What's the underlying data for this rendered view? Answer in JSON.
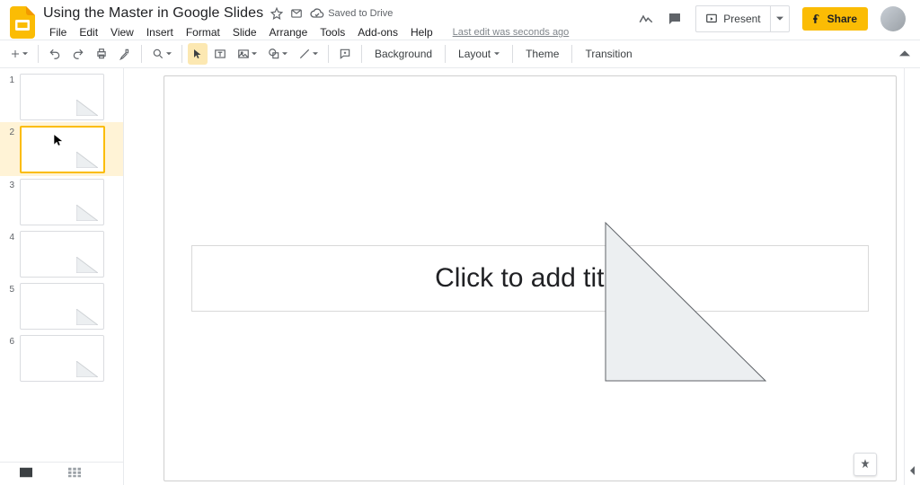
{
  "header": {
    "doc_title": "Using the Master in Google Slides",
    "saved_text": "Saved to Drive",
    "last_edit": "Last edit was seconds ago"
  },
  "menubar": [
    "File",
    "Edit",
    "View",
    "Insert",
    "Format",
    "Slide",
    "Arrange",
    "Tools",
    "Add-ons",
    "Help"
  ],
  "top_buttons": {
    "present": "Present",
    "share": "Share"
  },
  "toolbar": {
    "background": "Background",
    "layout": "Layout",
    "theme": "Theme",
    "transition": "Transition"
  },
  "filmstrip": {
    "slides": [
      1,
      2,
      3,
      4,
      5,
      6
    ],
    "selected": 2
  },
  "canvas": {
    "title_placeholder": "Click to add title"
  }
}
